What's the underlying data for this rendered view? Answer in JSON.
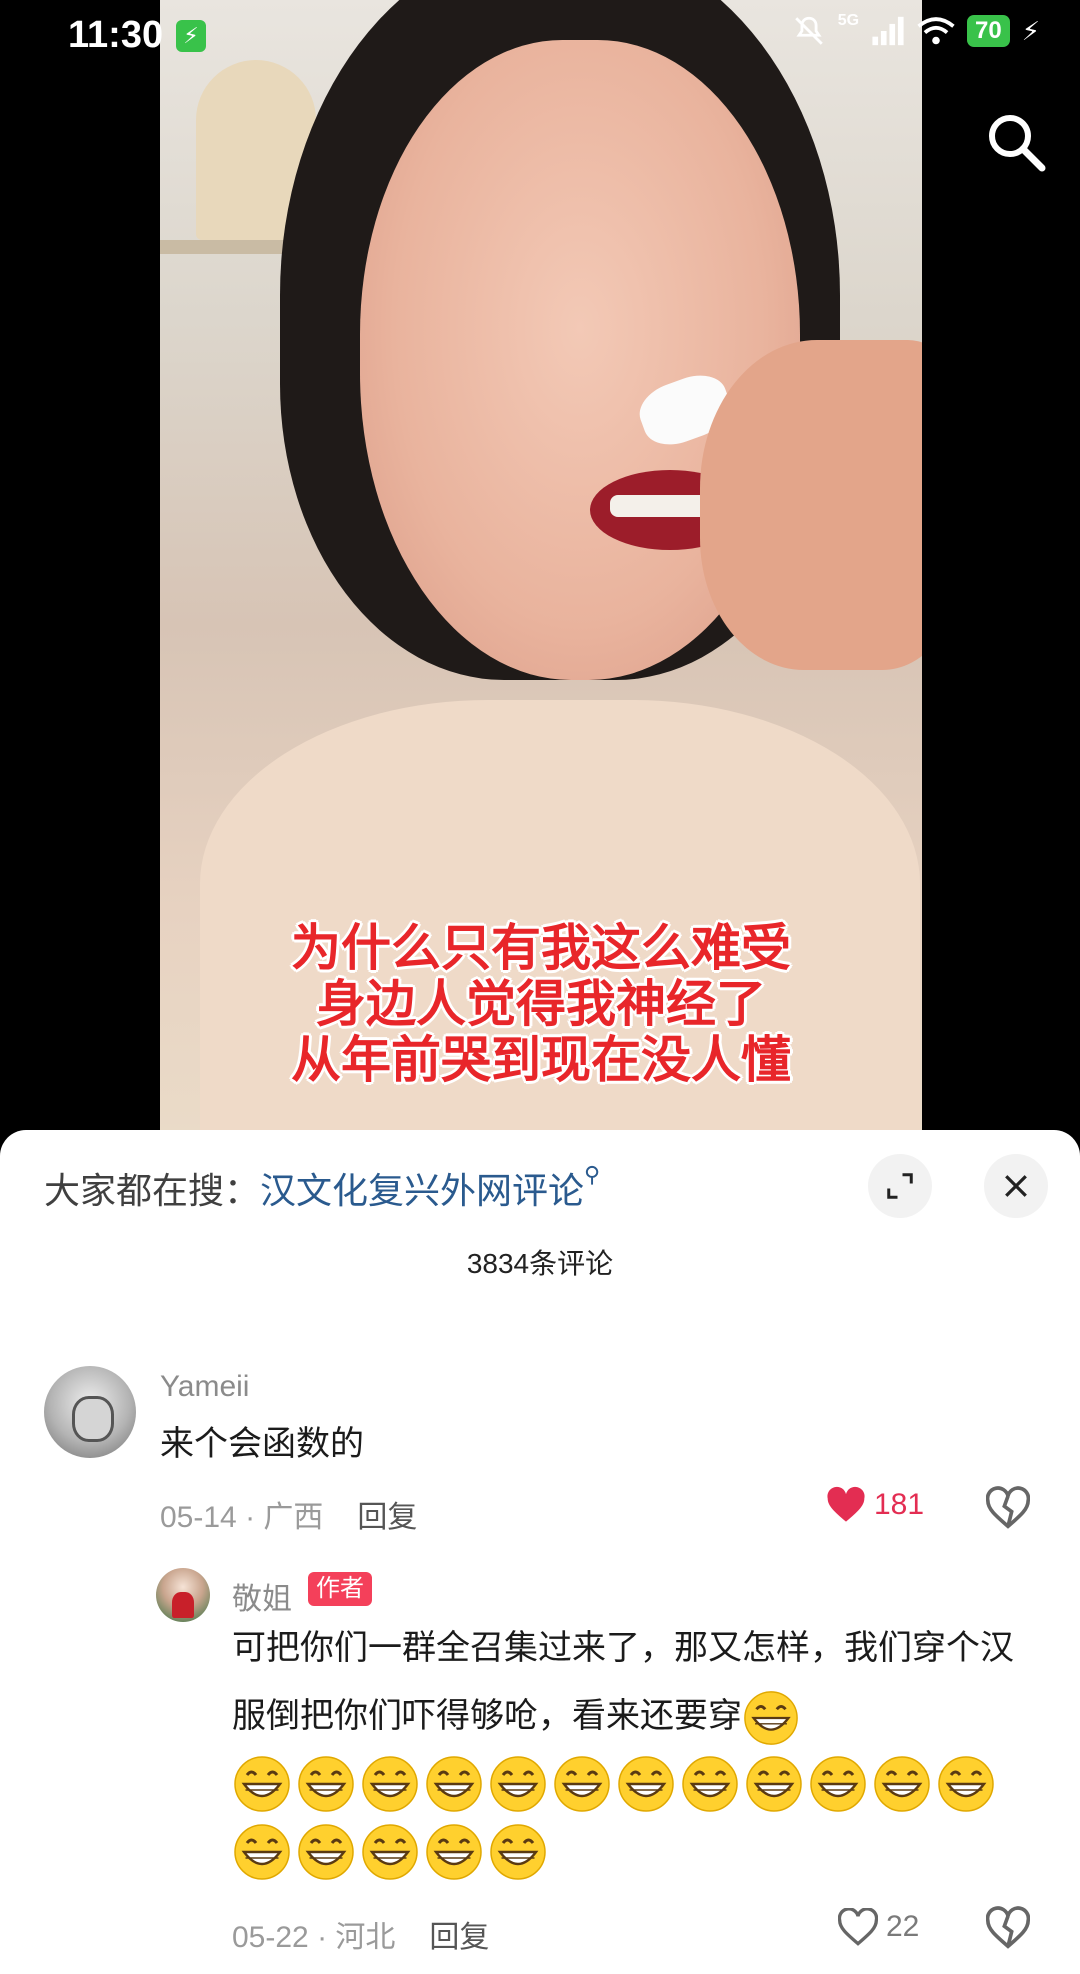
{
  "status_bar": {
    "time": "11:30",
    "network": "5G",
    "battery": "70"
  },
  "video": {
    "caption_lines": [
      "为什么只有我这么难受",
      "身边人觉得我神经了",
      "从年前哭到现在没人懂"
    ]
  },
  "comments_panel": {
    "hot_search_prefix": "大家都在搜：",
    "hot_search_term": "汉文化复兴外网评论",
    "comment_count": "3834条评论",
    "comments": [
      {
        "user": "Yameii",
        "text": "来个会函数的",
        "meta": "05-14 · 广西",
        "reply_label": "回复",
        "likes": "181",
        "liked": true
      }
    ],
    "reply": {
      "user": "敬姐",
      "badge": "作者",
      "text": "可把你们一群全召集过来了，那又怎样，我们穿个汉服倒把你们吓得够呛，看来还要穿",
      "emoji_name": "grinning-face-emoji",
      "emoji_rows": [
        1,
        12,
        5
      ],
      "meta": "05-22 · 河北",
      "reply_label": "回复",
      "likes": "22",
      "liked": false
    }
  },
  "colors": {
    "like_active": "#e32d52",
    "author_badge": "#f4405a",
    "hot_search_link": "#2a5a8e",
    "caption_red": "#e8262a"
  }
}
